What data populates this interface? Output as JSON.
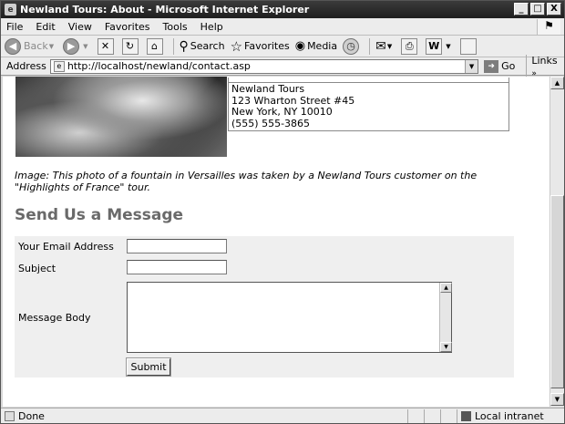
{
  "window": {
    "title": "Newland Tours: About - Microsoft Internet Explorer",
    "app_icon": "ie-icon",
    "buttons": {
      "minimize": "_",
      "maximize": "□",
      "close": "X"
    }
  },
  "menu": {
    "items": [
      "File",
      "Edit",
      "View",
      "Favorites",
      "Tools",
      "Help"
    ]
  },
  "toolbar": {
    "back": "Back",
    "search": "Search",
    "favorites": "Favorites",
    "media": "Media"
  },
  "addressbar": {
    "label": "Address",
    "url": "http://localhost/newland/contact.asp",
    "go": "Go",
    "links": "Links"
  },
  "page": {
    "address_lines": [
      "Newland Tours",
      "123 Wharton Street #45",
      "New York, NY 10010",
      "(555) 555-3865"
    ],
    "caption": "Image: This photo of a fountain in Versailles was taken by a Newland Tours customer on the \"Highlights of France\" tour.",
    "heading": "Send Us a Message",
    "form": {
      "email_label": "Your Email Address",
      "email_value": "",
      "subject_label": "Subject",
      "subject_value": "",
      "body_label": "Message Body",
      "body_value": "",
      "submit_label": "Submit"
    }
  },
  "status": {
    "text": "Done",
    "zone": "Local intranet"
  }
}
